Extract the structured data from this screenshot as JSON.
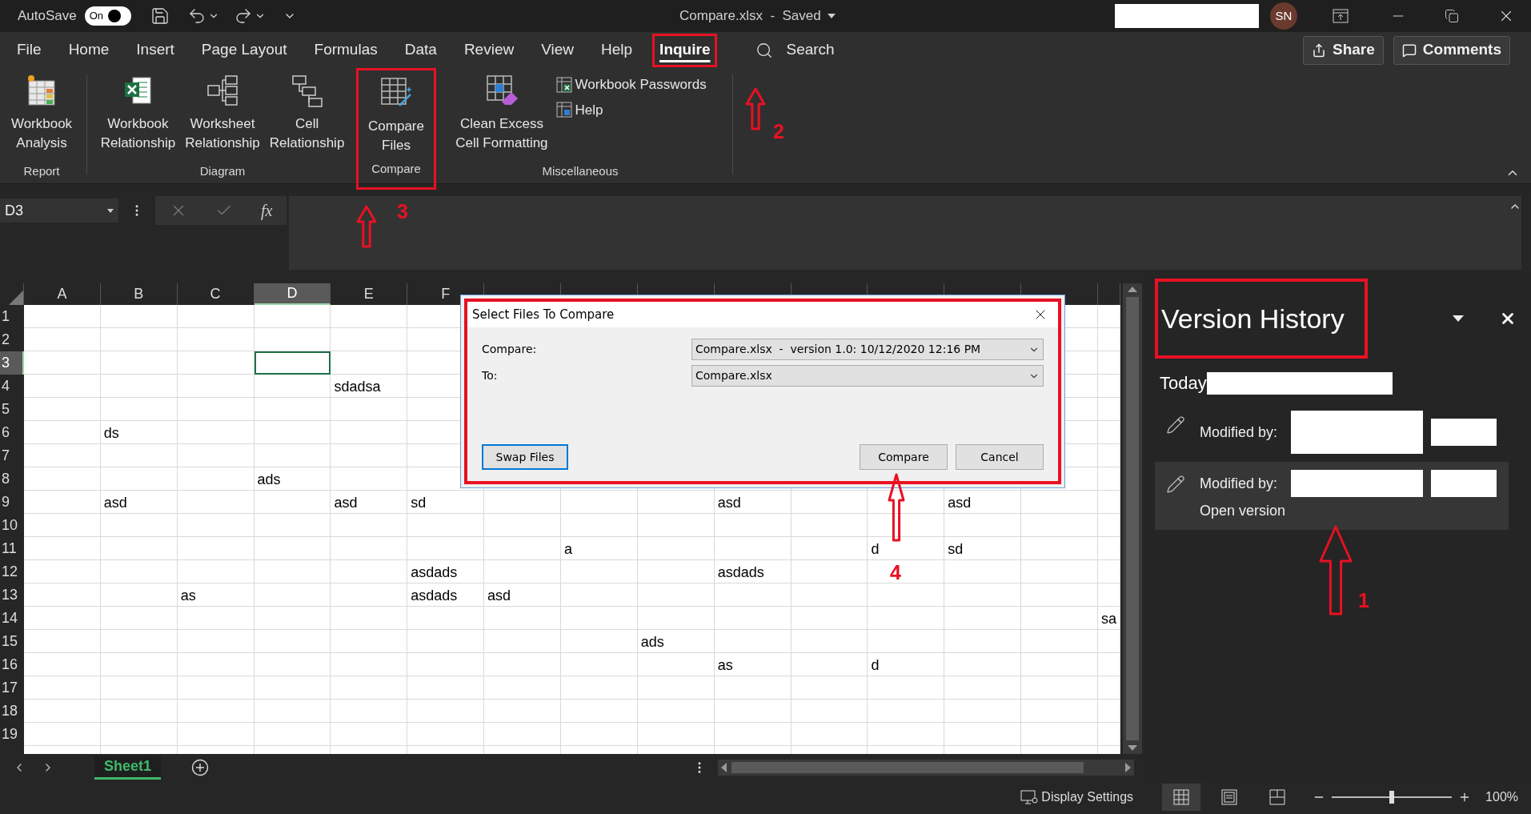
{
  "title_bar": {
    "autosave_label": "AutoSave",
    "autosave_toggle": {
      "label": "On",
      "on": true
    },
    "document_title": "Compare.xlsx  -  Saved",
    "avatar": "SN"
  },
  "tabs": [
    {
      "label": "File",
      "selected": false
    },
    {
      "label": "Home",
      "selected": false
    },
    {
      "label": "Insert",
      "selected": false
    },
    {
      "label": "Page Layout",
      "selected": false
    },
    {
      "label": "Formulas",
      "selected": false
    },
    {
      "label": "Data",
      "selected": false
    },
    {
      "label": "Review",
      "selected": false
    },
    {
      "label": "View",
      "selected": false
    },
    {
      "label": "Help",
      "selected": false
    },
    {
      "label": "Inquire",
      "selected": true,
      "highlighted": true,
      "callout": "2"
    }
  ],
  "search": {
    "label": "Search"
  },
  "share_button": "Share",
  "comments_button": "Comments",
  "ribbon_groups": [
    {
      "label": "Report",
      "commands": [
        {
          "kind": "large",
          "label_lines": [
            "Workbook",
            "Analysis"
          ]
        }
      ]
    },
    {
      "label": "Diagram",
      "commands": [
        {
          "kind": "large",
          "label_lines": [
            "Workbook",
            "Relationship"
          ]
        },
        {
          "kind": "large",
          "label_lines": [
            "Worksheet",
            "Relationship"
          ]
        },
        {
          "kind": "large",
          "label_lines": [
            "Cell",
            "Relationship"
          ]
        }
      ]
    },
    {
      "label": "Compare",
      "highlighted": true,
      "callout": "3",
      "commands": [
        {
          "kind": "large",
          "label_lines": [
            "Compare",
            "Files"
          ]
        }
      ]
    },
    {
      "label": "Miscellaneous",
      "commands": [
        {
          "kind": "large",
          "label_lines": [
            "Clean Excess",
            "Cell Formatting"
          ]
        },
        {
          "kind": "small",
          "label_lines": [
            "Workbook Passwords"
          ]
        },
        {
          "kind": "small",
          "label_lines": [
            "Help"
          ]
        }
      ]
    }
  ],
  "formula_bar": {
    "name_box": "D3",
    "function_label": "fx"
  },
  "columns": [
    {
      "label": "A",
      "selected": false
    },
    {
      "label": "B",
      "selected": false
    },
    {
      "label": "C",
      "selected": false
    },
    {
      "label": "D",
      "selected": true
    },
    {
      "label": "E",
      "selected": false
    },
    {
      "label": "F",
      "selected": false
    }
  ],
  "rows": [
    {
      "number": "1",
      "selected": false
    },
    {
      "number": "2",
      "selected": false
    },
    {
      "number": "3",
      "selected": true
    },
    {
      "number": "4",
      "selected": false,
      "cells": [
        null,
        null,
        null,
        null,
        "sdadsa",
        null,
        null,
        null,
        null,
        null,
        null,
        null,
        null,
        null,
        null
      ]
    },
    {
      "number": "5",
      "selected": false
    },
    {
      "number": "6",
      "selected": false,
      "cells": [
        null,
        "ds",
        null,
        null,
        null,
        null,
        null,
        null,
        null,
        null,
        null,
        null,
        null,
        null,
        null
      ]
    },
    {
      "number": "7",
      "selected": false
    },
    {
      "number": "8",
      "selected": false,
      "cells": [
        null,
        null,
        null,
        "ads",
        null,
        null,
        null,
        null,
        null,
        null,
        null,
        null,
        null,
        null,
        null
      ]
    },
    {
      "number": "9",
      "selected": false,
      "cells": [
        null,
        "asd",
        null,
        null,
        "asd",
        "sd",
        null,
        null,
        null,
        "asd",
        null,
        null,
        "asd",
        null,
        null
      ]
    },
    {
      "number": "10",
      "selected": false
    },
    {
      "number": "11",
      "selected": false,
      "cells": [
        null,
        null,
        null,
        null,
        null,
        null,
        null,
        "a",
        null,
        null,
        null,
        "d",
        "sd",
        null,
        null
      ]
    },
    {
      "number": "12",
      "selected": false,
      "cells": [
        null,
        null,
        null,
        null,
        null,
        "asdads",
        null,
        null,
        null,
        "asdads",
        null,
        null,
        null,
        null,
        null
      ]
    },
    {
      "number": "13",
      "selected": false,
      "cells": [
        null,
        null,
        "as",
        null,
        null,
        "asdads",
        "asd",
        null,
        null,
        null,
        null,
        null,
        null,
        null,
        null
      ]
    },
    {
      "number": "14",
      "selected": false,
      "cells": [
        null,
        null,
        null,
        null,
        null,
        null,
        null,
        null,
        null,
        null,
        null,
        null,
        null,
        null,
        "sa"
      ]
    },
    {
      "number": "15",
      "selected": false,
      "cells": [
        null,
        null,
        null,
        null,
        null,
        null,
        null,
        null,
        "ads",
        null,
        null,
        null,
        null,
        null,
        null
      ]
    },
    {
      "number": "16",
      "selected": false,
      "cells": [
        null,
        null,
        null,
        null,
        null,
        null,
        null,
        null,
        null,
        "as",
        null,
        "d",
        null,
        null,
        null
      ]
    },
    {
      "number": "17",
      "selected": false
    },
    {
      "number": "18",
      "selected": false
    },
    {
      "number": "19",
      "selected": false
    }
  ],
  "sheet_tabs": [
    {
      "label": "Sheet1",
      "selected": true
    }
  ],
  "dialog": {
    "title": "Select Files To Compare",
    "highlighted": true,
    "fields": [
      {
        "label": "Compare:",
        "value": "Compare.xlsx  -  version 1.0: 10/12/2020 12:16 PM"
      },
      {
        "label": "To:",
        "value": "Compare.xlsx"
      }
    ],
    "buttons": [
      {
        "kind": "swap",
        "label": "Swap Files",
        "focused": true
      },
      {
        "kind": "ok",
        "label": "Compare",
        "focused": false,
        "callout": "4"
      },
      {
        "kind": "cancel",
        "label": "Cancel",
        "focused": false
      }
    ]
  },
  "version_history": {
    "title": "Version History",
    "highlighted": true,
    "callout": "1",
    "group_label": "Today",
    "entries": [
      {
        "label": "Modified by:",
        "selected": false
      },
      {
        "label": "Modified by:",
        "link": "Open version",
        "selected": true
      }
    ]
  },
  "status_bar": {
    "display_settings": "Display Settings",
    "views": [
      {
        "kind": "normal",
        "selected": true
      },
      {
        "kind": "page_layout",
        "selected": false
      },
      {
        "kind": "page_break",
        "selected": false
      }
    ],
    "zoom": {
      "level": 0.5,
      "reading": "100%"
    }
  }
}
